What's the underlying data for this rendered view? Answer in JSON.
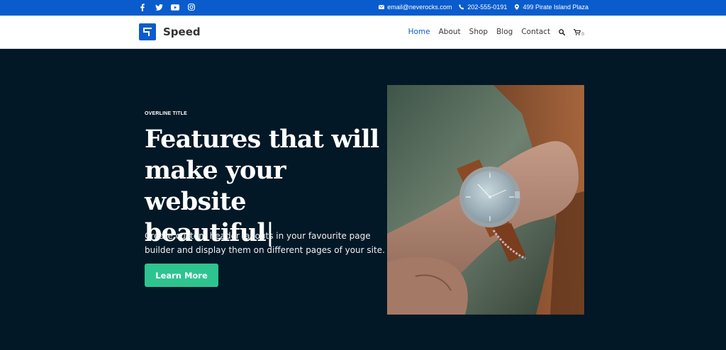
{
  "topbar": {
    "social": [
      "facebook-icon",
      "twitter-icon",
      "youtube-icon",
      "instagram-icon"
    ],
    "email": "email@neverocks.com",
    "phone": "202-555-0191",
    "address": "499 Pirate Island Plaza"
  },
  "header": {
    "brand": "Speed",
    "nav": [
      "Home",
      "About",
      "Shop",
      "Blog",
      "Contact"
    ],
    "cart_count": "0"
  },
  "hero": {
    "overline": "OVERLINE TITLE",
    "headline_line1": "Features that will",
    "headline_line2": "make your website",
    "headline_line3": "beautiful",
    "cursor": "|",
    "description": "Create custom header layouts in your favourite page builder and display them on different pages of your site.",
    "cta": "Learn More"
  },
  "colors": {
    "accent": "#0a5ccc",
    "hero_bg": "#021826",
    "cta": "#2ec48f"
  }
}
